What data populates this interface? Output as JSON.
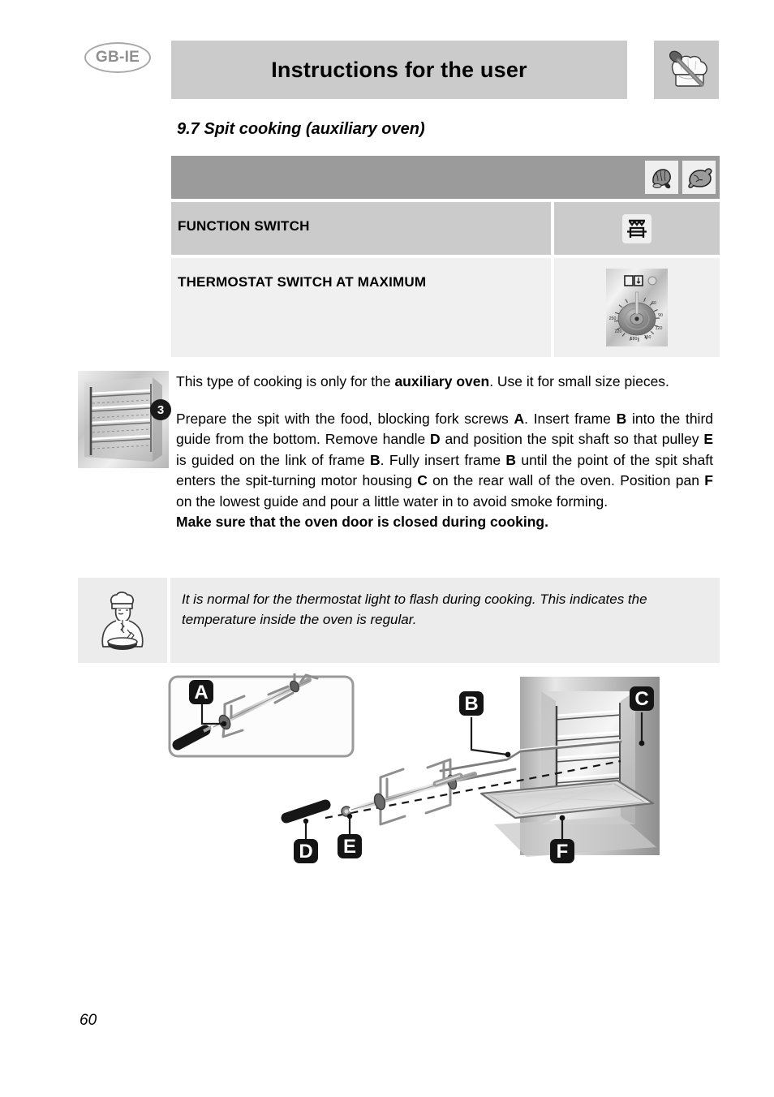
{
  "header": {
    "language_badge": "GB-IE",
    "title": "Instructions for the user",
    "icon": "chef-hat-spoon-icon"
  },
  "section": {
    "title": "9.7 Spit cooking (auxiliary oven)"
  },
  "settings_table": {
    "food_icons": [
      "roast-meat-icon",
      "roast-poultry-icon"
    ],
    "rows": [
      {
        "label": "FUNCTION SWITCH",
        "icon": "grill-with-spit-symbol"
      },
      {
        "label": "THERMOSTAT SWITCH AT MAXIMUM",
        "icon": "thermostat-dial-at-maximum"
      }
    ]
  },
  "thermostat_dial": {
    "tick_labels": [
      "60",
      "90",
      "120",
      "150",
      "180",
      "220",
      "250"
    ],
    "indicator_lights": [
      "oven-on-light",
      "thermostat-light"
    ]
  },
  "side_illustration": {
    "badge": "3",
    "icon": "oven-guides-icon"
  },
  "body": {
    "paragraph_1_a": "This type of cooking is only for the ",
    "paragraph_1_bold": "auxiliary oven",
    "paragraph_1_b": ". Use it for small size pieces.",
    "paragraph_2_1": "Prepare the spit with the food, blocking fork screws ",
    "paragraph_2_b1": "A",
    "paragraph_2_2": ". Insert frame ",
    "paragraph_2_b2": "B",
    "paragraph_2_3": " into the third guide from the bottom. Remove handle ",
    "paragraph_2_b3": "D",
    "paragraph_2_4": " and position the spit shaft so that pulley ",
    "paragraph_2_b4": "E",
    "paragraph_2_5": " is guided on the link of  frame ",
    "paragraph_2_b5": "B",
    "paragraph_2_6": ". Fully insert frame ",
    "paragraph_2_b6": "B",
    "paragraph_2_7": " until the point of the spit shaft enters the spit-turning motor housing ",
    "paragraph_2_b7": "C",
    "paragraph_2_8": " on the rear wall of the oven. Position pan ",
    "paragraph_2_b8": "F",
    "paragraph_2_9": " on the lowest guide and pour a little water in to avoid smoke forming.",
    "warning": "Make sure that the oven door is closed during cooking."
  },
  "note": {
    "icon": "chef-note-icon",
    "text": "It is normal for the thermostat light to flash during cooking. This indicates the temperature inside the oven is regular."
  },
  "diagram": {
    "labels": [
      "A",
      "B",
      "C",
      "D",
      "E",
      "F"
    ],
    "parts": {
      "A": "fork-screw",
      "B": "spit-frame",
      "C": "spit-turning-motor-housing",
      "D": "spit-handle",
      "E": "pulley",
      "F": "drip-pan"
    }
  },
  "footer": {
    "page_number": "60"
  },
  "colors": {
    "header_bar": "#cbcbcb",
    "table_head": "#9b9b9b",
    "row_light": "#f0f0f0",
    "row_mid": "#cbcbcb",
    "note_bg": "#ececec",
    "badge_text": "#8f8f8f"
  }
}
